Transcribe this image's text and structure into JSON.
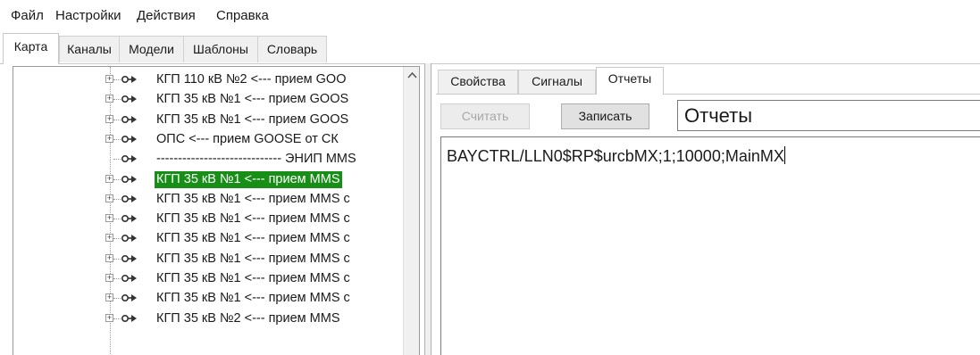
{
  "menu": [
    "Файл",
    "Настройки",
    "Действия",
    "Справка"
  ],
  "top_tabs": [
    {
      "label": "Карта",
      "active": true
    },
    {
      "label": "Каналы",
      "active": false
    },
    {
      "label": "Модели",
      "active": false
    },
    {
      "label": "Шаблоны",
      "active": false
    },
    {
      "label": "Словарь",
      "active": false
    }
  ],
  "tree": {
    "items": [
      {
        "label": "КГП 110 кВ №2 <--- прием GOO",
        "expandable": true,
        "selected": false
      },
      {
        "label": "КГП 35 кВ №1 <--- прием GOOS",
        "expandable": true,
        "selected": false
      },
      {
        "label": "КГП 35 кВ №1 <--- прием GOOS",
        "expandable": true,
        "selected": false
      },
      {
        "label": "ОПС <--- прием GOOSE от СК",
        "expandable": true,
        "selected": false
      },
      {
        "label": "----------------------------- ЭНИП MMS",
        "expandable": false,
        "selected": false
      },
      {
        "label": "КГП 35 кВ №1 <--- прием MMS",
        "expandable": true,
        "selected": true
      },
      {
        "label": "КГП 35 кВ №1 <--- прием MMS с",
        "expandable": true,
        "selected": false
      },
      {
        "label": "КГП 35 кВ №1 <--- прием MMS с",
        "expandable": true,
        "selected": false
      },
      {
        "label": "КГП 35 кВ №1 <--- прием MMS с",
        "expandable": true,
        "selected": false
      },
      {
        "label": "КГП 35 кВ №1 <--- прием MMS с",
        "expandable": true,
        "selected": false
      },
      {
        "label": "КГП 35 кВ №1 <--- прием MMS с",
        "expandable": true,
        "selected": false
      },
      {
        "label": "КГП 35 кВ №1 <--- прием MMS с",
        "expandable": true,
        "selected": false
      },
      {
        "label": "КГП 35 кВ №2 <--- прием MMS",
        "expandable": true,
        "selected": false
      }
    ],
    "selected_color": "#178f17"
  },
  "right": {
    "tabs": [
      {
        "label": "Свойства",
        "active": false
      },
      {
        "label": "Сигналы",
        "active": false
      },
      {
        "label": "Отчеты",
        "active": true
      }
    ],
    "read_button": "Считать",
    "write_button": "Записать",
    "title_value": "Отчеты",
    "editor_text": "BAYCTRL/LLN0$RP$urcbMX;1;10000;MainMX"
  }
}
